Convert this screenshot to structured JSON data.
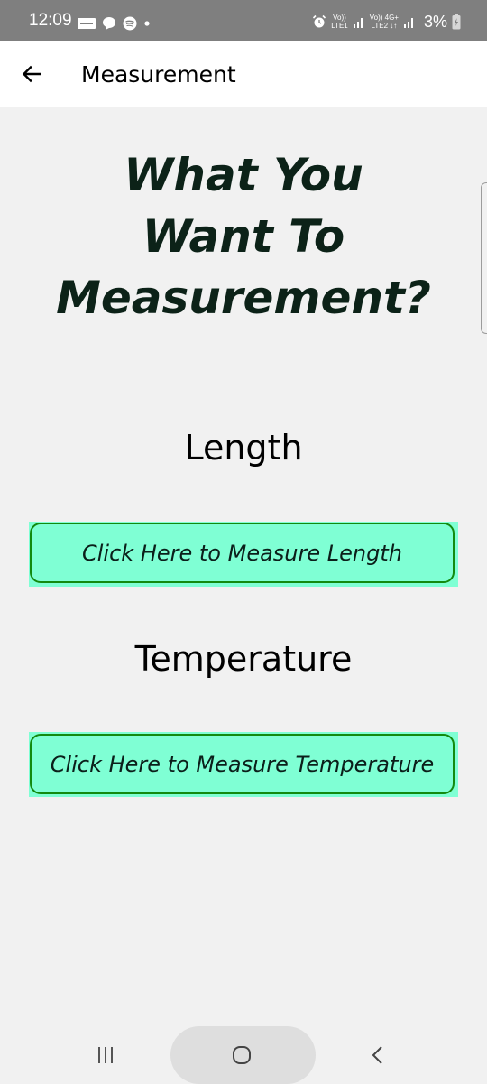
{
  "status_bar": {
    "time": "12:09",
    "net1_top": "Vo))",
    "net1_bottom": "LTE1",
    "net2_top": "Vo)) 4G+",
    "net2_bottom": "LTE2 ↓↑",
    "battery": "3%",
    "icons": [
      "notification-app-icon",
      "chat-bubble-icon",
      "spotify-icon",
      "dot-icon",
      "alarm-icon",
      "signal-icon",
      "signal-icon",
      "battery-charging-icon"
    ]
  },
  "app_bar": {
    "title": "Measurement",
    "back_icon": "arrow-left-icon"
  },
  "main": {
    "headline": [
      "What You",
      "Want To",
      "Measurement?"
    ],
    "length_label": "Length",
    "length_button": "Click Here to Measure Length",
    "temperature_label": "Temperature",
    "temperature_button": "Click Here to Measure Temperature"
  },
  "nav_bar": {
    "icons": [
      "recent-apps-icon",
      "home-icon",
      "back-icon"
    ]
  },
  "colors": {
    "status_bar": "#7f7f7f",
    "app_bar": "#ffffff",
    "background": "#f1f1f1",
    "button_fill": "#7fffd4",
    "button_border": "#138a0f",
    "headline": "#0c2218"
  }
}
